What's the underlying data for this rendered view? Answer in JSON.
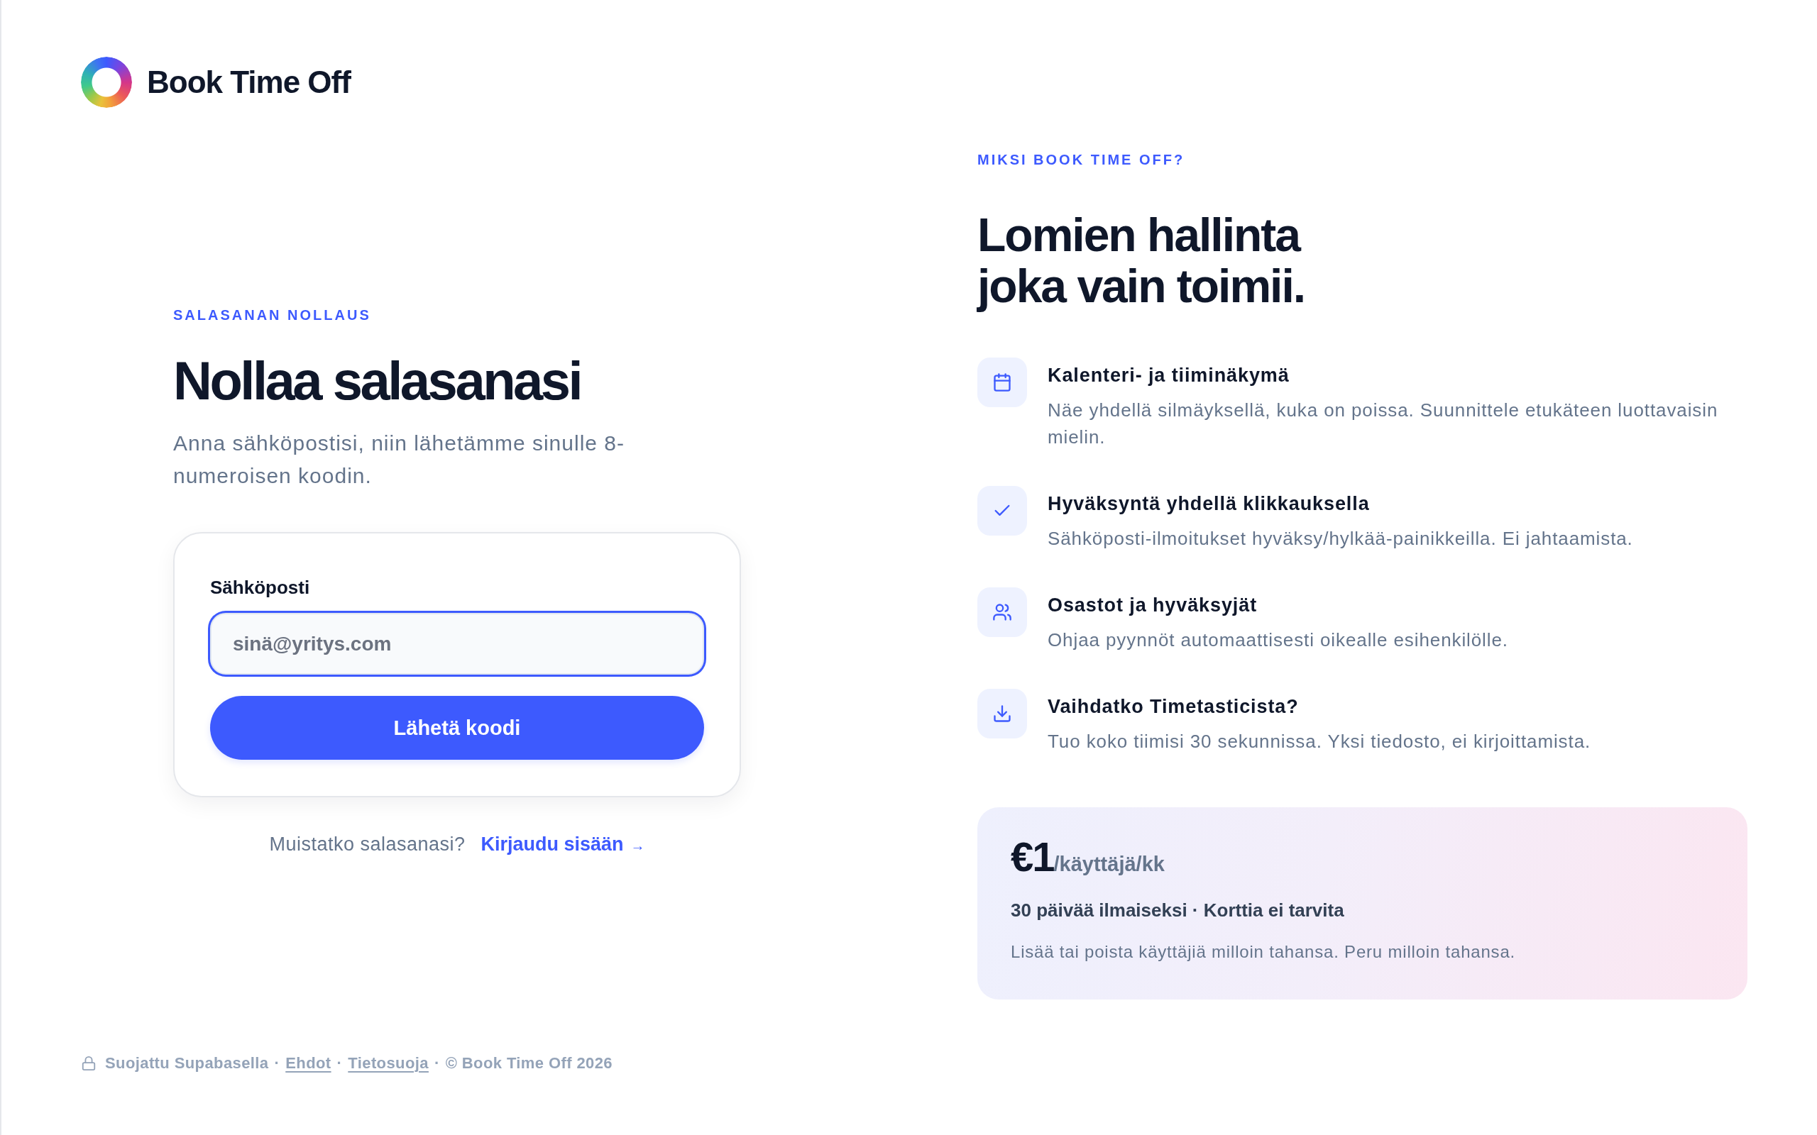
{
  "brand": {
    "name": "Book Time Off"
  },
  "reset_form": {
    "eyebrow": "SALASANAN NOLLAUS",
    "title": "Nollaa salasanasi",
    "subtitle": "Anna sähköpostisi, niin lähetämme sinulle 8-numeroisen koodin.",
    "email_field": {
      "label": "Sähköposti",
      "placeholder": "sinä@yritys.com",
      "focused": true
    },
    "submit_button": "Lähetä koodi",
    "signin_prompt": {
      "text": "Muistatko salasanasi?",
      "link": "Kirjaudu sisään",
      "link_arrow": "→"
    }
  },
  "footer": {
    "items": [
      {
        "kind": "text",
        "text": "Suojattu Supabasella"
      },
      {
        "kind": "separator",
        "text": "·"
      },
      {
        "kind": "link",
        "text": "Ehdot"
      },
      {
        "kind": "separator",
        "text": "·"
      },
      {
        "kind": "link",
        "text": "Tietosuoja"
      },
      {
        "kind": "separator",
        "text": "·"
      },
      {
        "kind": "text",
        "text": "© Book Time Off 2026"
      }
    ]
  },
  "why_panel": {
    "eyebrow": "MIKSI BOOK TIME OFF?",
    "title_lines": [
      "Lomien hallinta",
      "joka vain toimii."
    ],
    "features": [
      {
        "title": "Kalenteri- ja tiiminäkymä",
        "description": "Näe yhdellä silmäyksellä, kuka on poissa. Suunnittele etukäteen luottavaisin mielin."
      },
      {
        "title": "Hyväksyntä yhdellä klikkauksella",
        "description": "Sähköposti-ilmoitukset hyväksy/hylkää-painikkeilla. Ei jahtaamista."
      },
      {
        "title": "Osastot ja hyväksyjät",
        "description": "Ohjaa pyynnöt automaattisesti oikealle esihenkilölle."
      },
      {
        "title": "Vaihdatko Timetasticista?",
        "description": "Tuo koko tiimisi 30 sekunnissa. Yksi tiedosto, ei kirjoittamista."
      }
    ],
    "pricing": {
      "price": "€1",
      "unit": "/käyttäjä/kk",
      "trial": "30 päivää ilmaiseksi · Korttia ei tarvita",
      "note": "Lisää tai poista käyttäjiä milloin tahansa. Peru milloin tahansa."
    }
  }
}
